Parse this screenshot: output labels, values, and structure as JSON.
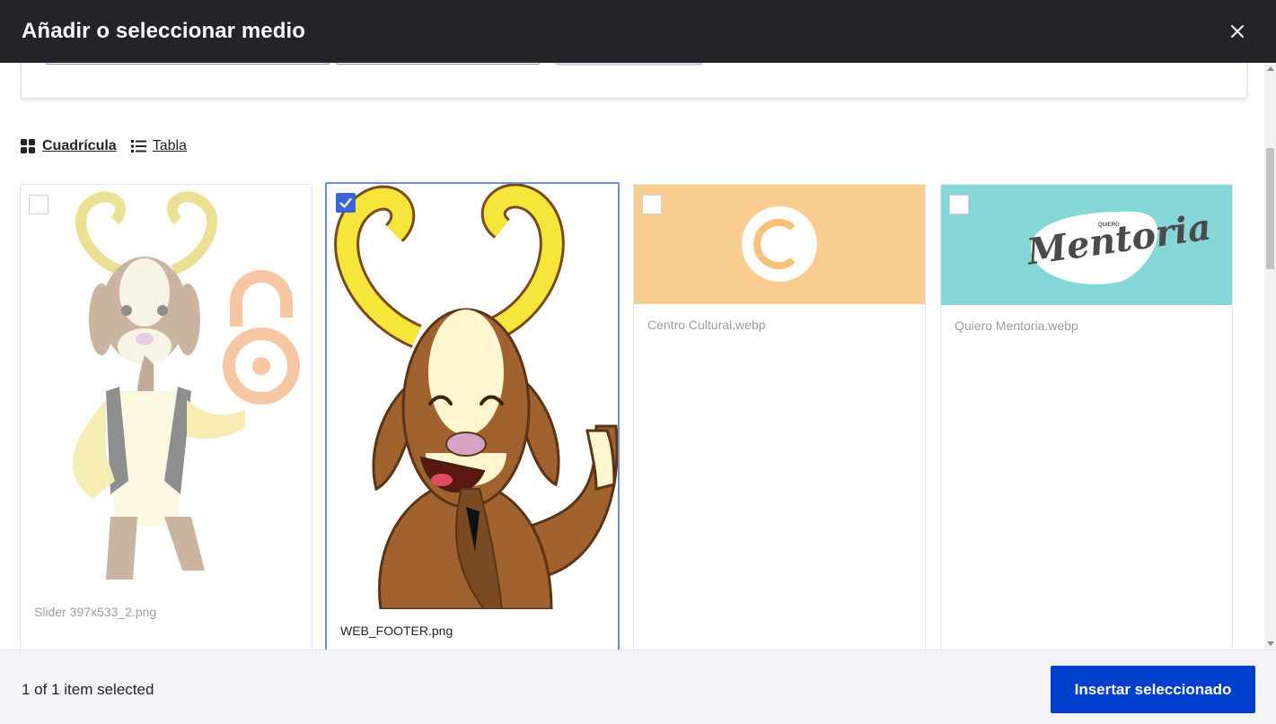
{
  "dialog": {
    "title": "Añadir o seleccionar medio",
    "close_icon": "close-icon"
  },
  "view_switch": {
    "grid_label": "Cuadrícula",
    "grid_icon": "grid-icon",
    "table_label": "Tabla",
    "table_icon": "list-icon",
    "active": "grid"
  },
  "media_items": [
    {
      "filename": "Slider 397x533_2.png",
      "selected": false
    },
    {
      "filename": "WEB_FOOTER.png",
      "selected": true
    },
    {
      "filename": "Centro Cultural.webp",
      "selected": false
    },
    {
      "filename": "Quiero Mentoria.webp",
      "selected": false
    }
  ],
  "thumbnails": {
    "mentoria_small": "QUIERO",
    "mentoria_big": "Mentoria"
  },
  "footer": {
    "selection_count": "1 of 1 item selected",
    "insert_label": "Insertar seleccionado"
  },
  "colors": {
    "titlebar": "#232429",
    "primary_button": "#003ecc",
    "checkbox_checked": "#3a66d6",
    "centro_bg": "#f9cd8f",
    "mentoria_bg": "#85d6d6"
  }
}
